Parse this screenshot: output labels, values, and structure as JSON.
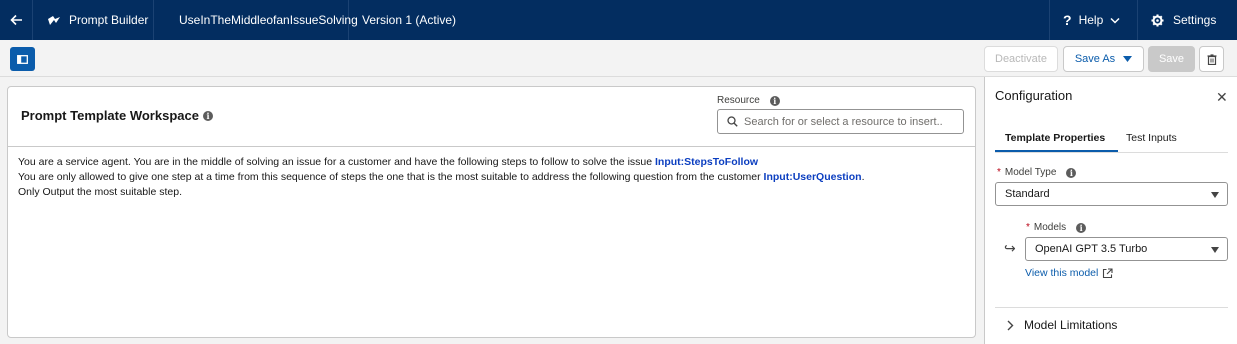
{
  "header": {
    "app_name": "Prompt Builder",
    "template_name": "UseInTheMiddleofanIssueSolving",
    "version": "Version 1 (Active)",
    "help_label": "Help",
    "settings_label": "Settings"
  },
  "toolbar": {
    "deactivate_label": "Deactivate",
    "save_as_label": "Save As",
    "save_label": "Save"
  },
  "workspace": {
    "title": "Prompt Template Workspace",
    "resource_label": "Resource",
    "resource_placeholder": "Search for or select a resource to insert..",
    "prompt": {
      "line1_text": "You are a service agent. You are in the middle of solving an issue for a customer and have the following steps to follow to solve the issue",
      "line1_merge": "Input:StepsToFollow",
      "line2_text": "You are only allowed to give one step at a time from this sequence of steps the one that is the most suitable to address the following question from the customer",
      "line2_merge": "Input:UserQuestion",
      "line2_end": ".",
      "line3_text": "Only Output the most suitable step."
    }
  },
  "config": {
    "title": "Configuration",
    "tabs": [
      "Template Properties",
      "Test Inputs"
    ],
    "active_tab": "Template Properties",
    "model_type_label": "Model Type",
    "model_type_value": "Standard",
    "models_label": "Models",
    "models_value": "OpenAI GPT 3.5 Turbo",
    "view_model_link": "View this model",
    "limitations_label": "Model Limitations"
  },
  "colors": {
    "header_bg": "#032d60",
    "brand_blue": "#0b5cab",
    "merge_field": "#0b3ec0",
    "required": "#ba0517"
  }
}
